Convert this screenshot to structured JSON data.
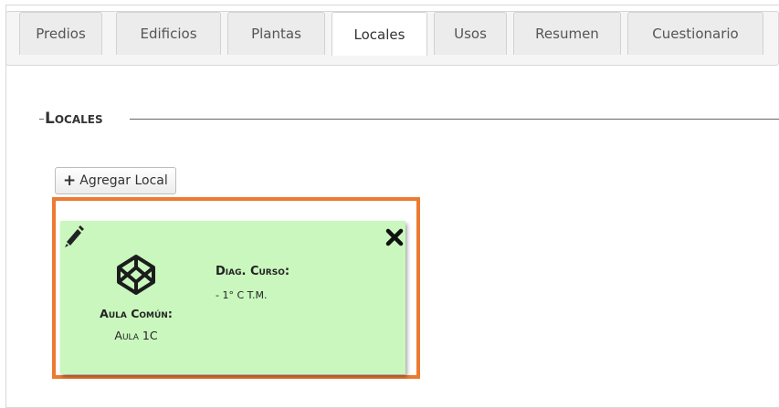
{
  "tabs": [
    {
      "label": "Predios",
      "active": false
    },
    {
      "label": "Edificios",
      "active": false
    },
    {
      "label": "Plantas",
      "active": false
    },
    {
      "label": "Locales",
      "active": true
    },
    {
      "label": "Usos",
      "active": false
    },
    {
      "label": "Resumen",
      "active": false
    },
    {
      "label": "Cuestionario",
      "active": false
    }
  ],
  "section": {
    "legend": "Locales"
  },
  "toolbar": {
    "add_icon": "+",
    "add_label": "Agregar Local"
  },
  "card": {
    "background": "#c9f7be",
    "highlight_color": "#ec7a30",
    "icons": {
      "edit": "pencil-icon",
      "close": "close-icon",
      "type": "codepen-cube-icon"
    },
    "type_label": "Aula Común:",
    "type_value": "Aula 1C",
    "diag_label": "Diag. Curso:",
    "diag_items": [
      "- 1° C T.M."
    ]
  }
}
